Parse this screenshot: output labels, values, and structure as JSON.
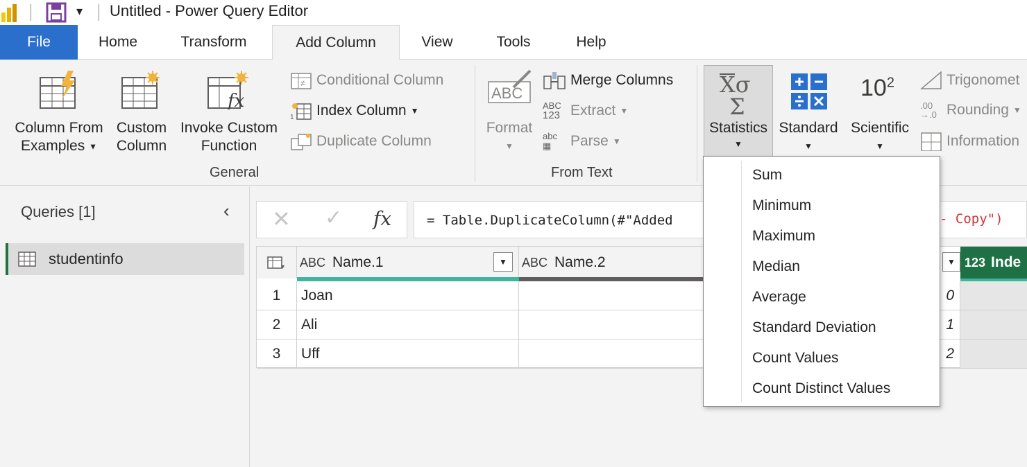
{
  "window": {
    "title": "Untitled - Power Query Editor"
  },
  "tabs": {
    "file": "File",
    "home": "Home",
    "transform": "Transform",
    "add_column": "Add Column",
    "view": "View",
    "tools": "Tools",
    "help": "Help"
  },
  "ribbon": {
    "general": {
      "label": "General",
      "column_from_examples_1": "Column From",
      "column_from_examples_2": "Examples",
      "custom_column_1": "Custom",
      "custom_column_2": "Column",
      "invoke_custom_1": "Invoke Custom",
      "invoke_custom_2": "Function",
      "conditional_column": "Conditional Column",
      "index_column": "Index Column",
      "duplicate_column": "Duplicate Column"
    },
    "from_text": {
      "label": "From Text",
      "format": "Format",
      "merge_columns": "Merge Columns",
      "extract": "Extract",
      "parse": "Parse",
      "extract_icon_text_1": "ABC",
      "extract_icon_text_2": "123",
      "parse_icon_text": "abc",
      "format_icon_text": "ABC"
    },
    "from_number": {
      "statistics": "Statistics",
      "standard": "Standard",
      "scientific": "Scientific",
      "scientific_icon_base": "10",
      "scientific_icon_exp": "2",
      "trigonometry": "Trigonomet",
      "rounding": "Rounding",
      "information": "Information"
    }
  },
  "queries": {
    "header": "Queries [1]",
    "items": [
      {
        "name": "studentinfo"
      }
    ]
  },
  "formula_bar": {
    "fx": "fx",
    "formula_left": "= Table.DuplicateColumn(#\"Added",
    "formula_right": "- Copy\")"
  },
  "grid": {
    "columns": [
      {
        "type": "ABC",
        "name": "Name.1"
      },
      {
        "type": "ABC",
        "name": "Name.2"
      },
      {
        "type": "123",
        "name": "Inde"
      }
    ],
    "rows": [
      {
        "num": "1",
        "name1": "Joan",
        "name2": "",
        "index": "0"
      },
      {
        "num": "2",
        "name1": "Ali",
        "name2": "",
        "index": "1"
      },
      {
        "num": "3",
        "name1": "Uff",
        "name2": "",
        "index": "2"
      }
    ]
  },
  "statistics_menu": {
    "items": [
      "Sum",
      "Minimum",
      "Maximum",
      "Median",
      "Average",
      "Standard Deviation",
      "Count Values",
      "Count Distinct Values"
    ]
  },
  "colors": {
    "file_tab": "#2b6fcd",
    "accent_teal": "#3fb59f",
    "selected_query_bar": "#217346",
    "index_header": "#1e7145"
  }
}
